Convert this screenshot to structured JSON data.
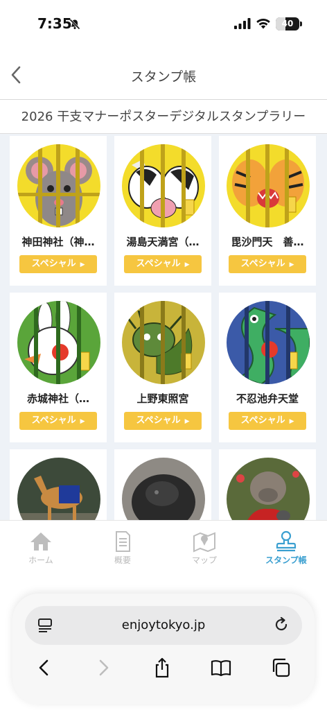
{
  "status": {
    "time": "7:35",
    "battery": "40"
  },
  "header": {
    "title": "スタンプ帳"
  },
  "subtitle": "2026 干支マナーポスターデジタルスタンプラリー",
  "stamps": [
    {
      "name": "神田神社（神…",
      "button": "スペシャル"
    },
    {
      "name": "湯島天満宮（…",
      "button": "スペシャル"
    },
    {
      "name": "毘沙門天　善…",
      "button": "スペシャル"
    },
    {
      "name": "赤城神社（…",
      "button": "スペシャル"
    },
    {
      "name": "上野東照宮",
      "button": "スペシャル"
    },
    {
      "name": "不忍池弁天堂",
      "button": "スペシャル"
    },
    {
      "name": "",
      "button": ""
    },
    {
      "name": "",
      "button": ""
    },
    {
      "name": "",
      "button": ""
    }
  ],
  "tabs": [
    {
      "label": "ホーム",
      "icon": "home-icon"
    },
    {
      "label": "概要",
      "icon": "document-icon"
    },
    {
      "label": "マップ",
      "icon": "map-icon"
    },
    {
      "label": "スタンプ帳",
      "icon": "stamp-icon"
    }
  ],
  "browser": {
    "url": "enjoytokyo.jp"
  },
  "colors": {
    "accent": "#3a9fd0",
    "button": "#f6c640",
    "grid_bg": "#eef2f7"
  }
}
